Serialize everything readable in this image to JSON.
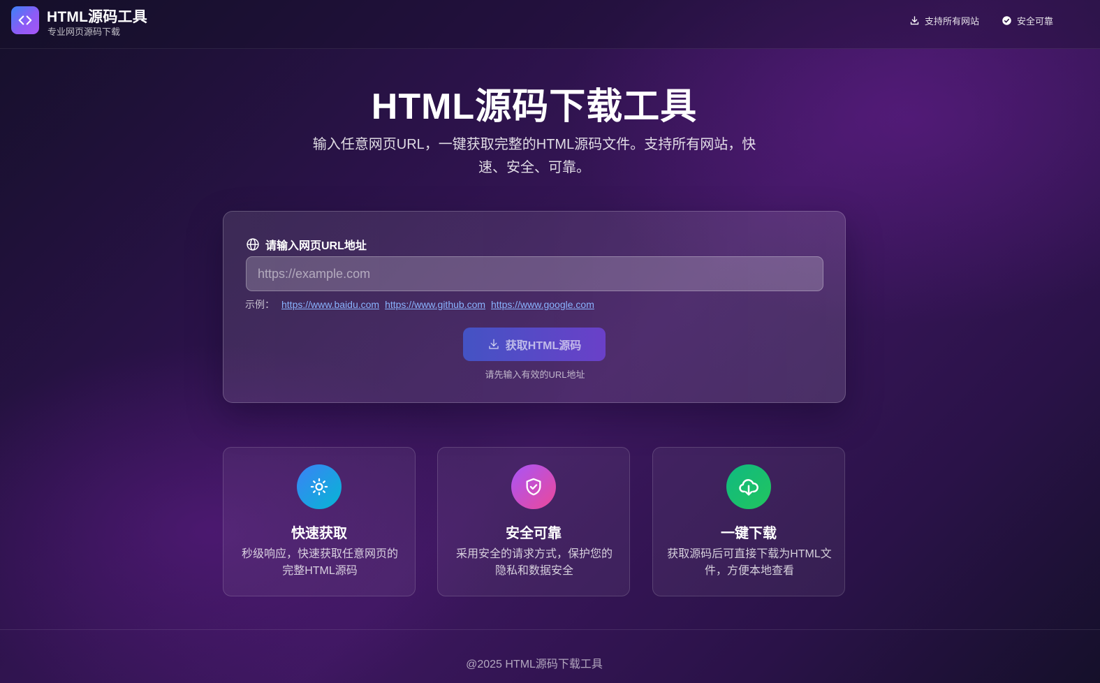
{
  "header": {
    "brand_title": "HTML源码工具",
    "brand_subtitle": "专业网页源码下载",
    "nav": [
      {
        "label": "支持所有网站",
        "icon": "download-icon"
      },
      {
        "label": "安全可靠",
        "icon": "check-circle-icon"
      }
    ]
  },
  "hero": {
    "title": "HTML源码下载工具",
    "description": "输入任意网页URL，一键获取完整的HTML源码文件。支持所有网站，快速、安全、可靠。"
  },
  "form": {
    "label": "请输入网页URL地址",
    "label_icon": "globe-icon",
    "input_value": "",
    "input_placeholder": "https://example.com",
    "examples_label": "示例：",
    "examples": [
      "https://www.baidu.com",
      "https://www.github.com",
      "https://www.google.com"
    ],
    "submit_label": "获取HTML源码",
    "submit_icon": "download-icon",
    "hint": "请先输入有效的URL地址"
  },
  "features": [
    {
      "title": "快速获取",
      "description": "秒级响应，快速获取任意网页的完整HTML源码",
      "icon": "sun-icon",
      "colors": [
        "#3b82f6",
        "#06b6d4"
      ]
    },
    {
      "title": "安全可靠",
      "description": "采用安全的请求方式，保护您的隐私和数据安全",
      "icon": "shield-check-icon",
      "colors": [
        "#a855f7",
        "#ec4899"
      ]
    },
    {
      "title": "一键下载",
      "description": "获取源码后可直接下载为HTML文件，方便本地查看",
      "icon": "cloud-download-icon",
      "colors": [
        "#10b981",
        "#22c55e"
      ]
    }
  ],
  "footer": {
    "text": "@2025 HTML源码下载工具"
  },
  "colors": {
    "accent": "#6a40c8",
    "link": "#8ab4ff"
  }
}
